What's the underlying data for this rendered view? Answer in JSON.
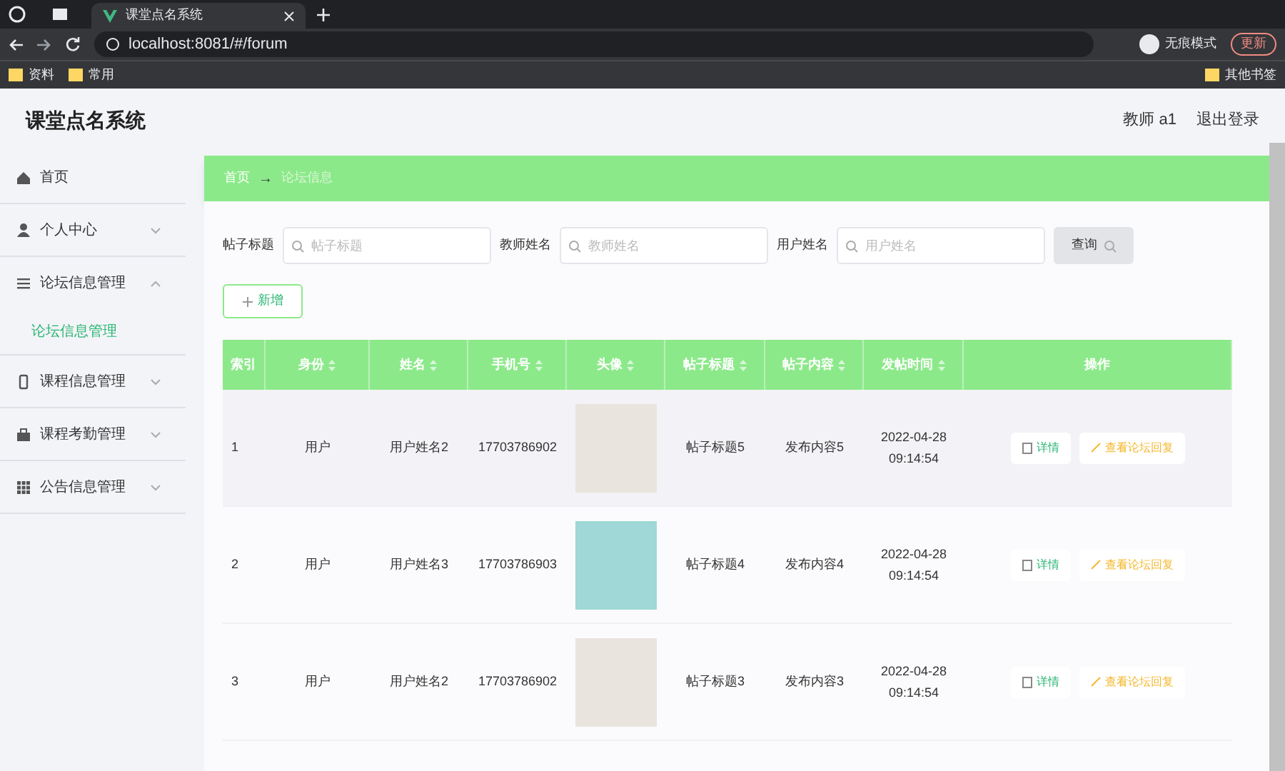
{
  "browser": {
    "tab_title": "课堂点名系统",
    "url": "localhost:8081/#/forum",
    "incognito_label": "无痕模式",
    "update_button": "更新",
    "bookmarks": [
      "资料",
      "常用"
    ],
    "other_bookmarks": "其他书签"
  },
  "header": {
    "title": "课堂点名系统",
    "user": "教师 a1",
    "logout": "退出登录"
  },
  "sidebar": {
    "items": [
      {
        "label": "首页"
      },
      {
        "label": "个人中心",
        "expanded": false
      },
      {
        "label": "论坛信息管理",
        "expanded": true,
        "children": [
          {
            "label": "论坛信息管理",
            "selected": true
          }
        ]
      },
      {
        "label": "课程信息管理",
        "expanded": false
      },
      {
        "label": "课程考勤管理",
        "expanded": false
      },
      {
        "label": "公告信息管理",
        "expanded": false
      }
    ]
  },
  "breadcrumb": {
    "home": "首页",
    "separator": "→",
    "current": "论坛信息"
  },
  "search": {
    "fields": [
      {
        "label": "帖子标题",
        "placeholder": "帖子标题"
      },
      {
        "label": "教师姓名",
        "placeholder": "教师姓名"
      },
      {
        "label": "用户姓名",
        "placeholder": "用户姓名"
      }
    ],
    "button": "查询"
  },
  "add_button": "新增",
  "table": {
    "columns": [
      {
        "label": "索引",
        "sortable": false
      },
      {
        "label": "身份",
        "sortable": true
      },
      {
        "label": "姓名",
        "sortable": true
      },
      {
        "label": "手机号",
        "sortable": true
      },
      {
        "label": "头像",
        "sortable": true
      },
      {
        "label": "帖子标题",
        "sortable": true
      },
      {
        "label": "帖子内容",
        "sortable": true
      },
      {
        "label": "发帖时间",
        "sortable": true
      },
      {
        "label": "操作",
        "sortable": false
      }
    ],
    "rows": [
      {
        "index": "1",
        "role": "用户",
        "name": "用户姓名2",
        "phone": "17703786902",
        "avatar": {
          "kind": "illustration"
        },
        "post_title": "帖子标题5",
        "post_content": "发布内容5",
        "post_time": "2022-04-28 09:14:54",
        "actions": [
          "详情",
          "查看论坛回复"
        ]
      },
      {
        "index": "2",
        "role": "用户",
        "name": "用户姓名3",
        "phone": "17703786903",
        "avatar": {
          "kind": "photo"
        },
        "post_title": "帖子标题4",
        "post_content": "发布内容4",
        "post_time": "2022-04-28 09:14:54",
        "actions": [
          "详情",
          "查看论坛回复"
        ]
      },
      {
        "index": "3",
        "role": "用户",
        "name": "用户姓名2",
        "phone": "17703786902",
        "avatar": {
          "kind": "illustration"
        },
        "post_title": "帖子标题3",
        "post_content": "发布内容3",
        "post_time": "2022-04-28 09:14:54",
        "actions": [
          "详情",
          "查看论坛回复"
        ]
      }
    ]
  }
}
